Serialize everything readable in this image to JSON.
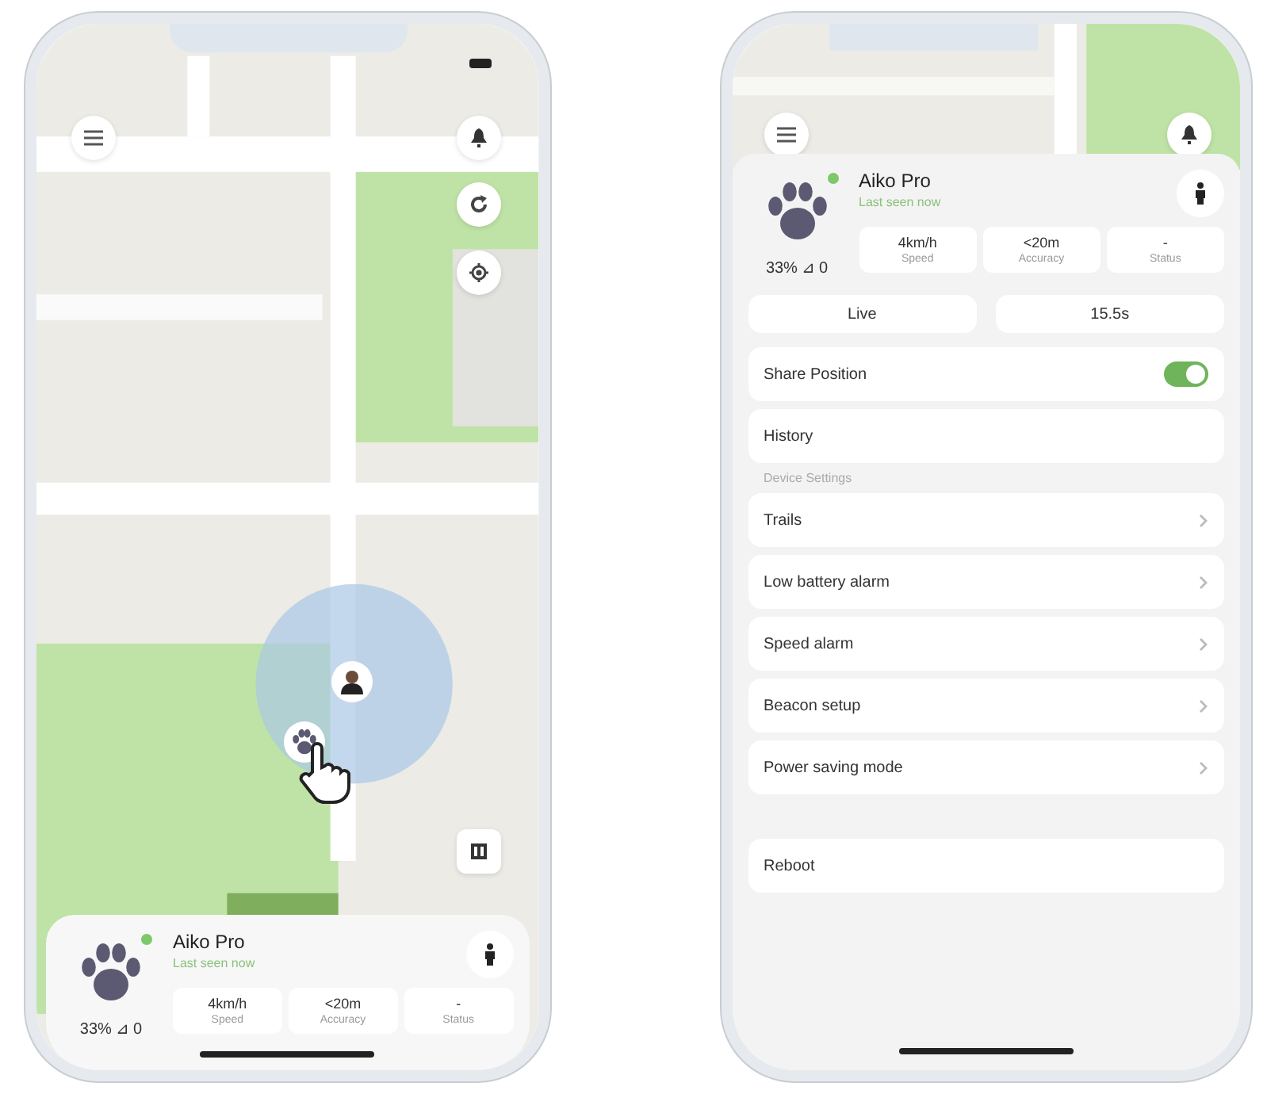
{
  "map_screen": {
    "device": {
      "name": "Aiko Pro",
      "subtitle": "Last seen now",
      "online": true,
      "battery": "33% ⊿ 0",
      "stats": [
        {
          "value": "4km/h",
          "label": "Speed"
        },
        {
          "value": "<20m",
          "label": "Accuracy"
        },
        {
          "value": "-",
          "label": "Status"
        }
      ]
    }
  },
  "settings_screen": {
    "device": {
      "name": "Aiko Pro",
      "subtitle": "Last seen now",
      "online": true,
      "battery": "33% ⊿ 0",
      "stats": [
        {
          "value": "4km/h",
          "label": "Speed"
        },
        {
          "value": "<20m",
          "label": "Accuracy"
        },
        {
          "value": "-",
          "label": "Status"
        }
      ]
    },
    "modes": [
      "Live",
      "15.5s"
    ],
    "items": [
      {
        "kind": "toggle",
        "label": "Share Position",
        "on": true
      },
      {
        "kind": "plain",
        "label": "History"
      },
      {
        "kind": "header",
        "label": "Device Settings"
      },
      {
        "kind": "link",
        "label": "Trails"
      },
      {
        "kind": "link",
        "label": "Low battery alarm"
      },
      {
        "kind": "link",
        "label": "Speed alarm"
      },
      {
        "kind": "link",
        "label": "Beacon setup"
      },
      {
        "kind": "link",
        "label": "Power saving mode"
      },
      {
        "kind": "gap"
      },
      {
        "kind": "plain",
        "label": "Reboot"
      }
    ]
  }
}
